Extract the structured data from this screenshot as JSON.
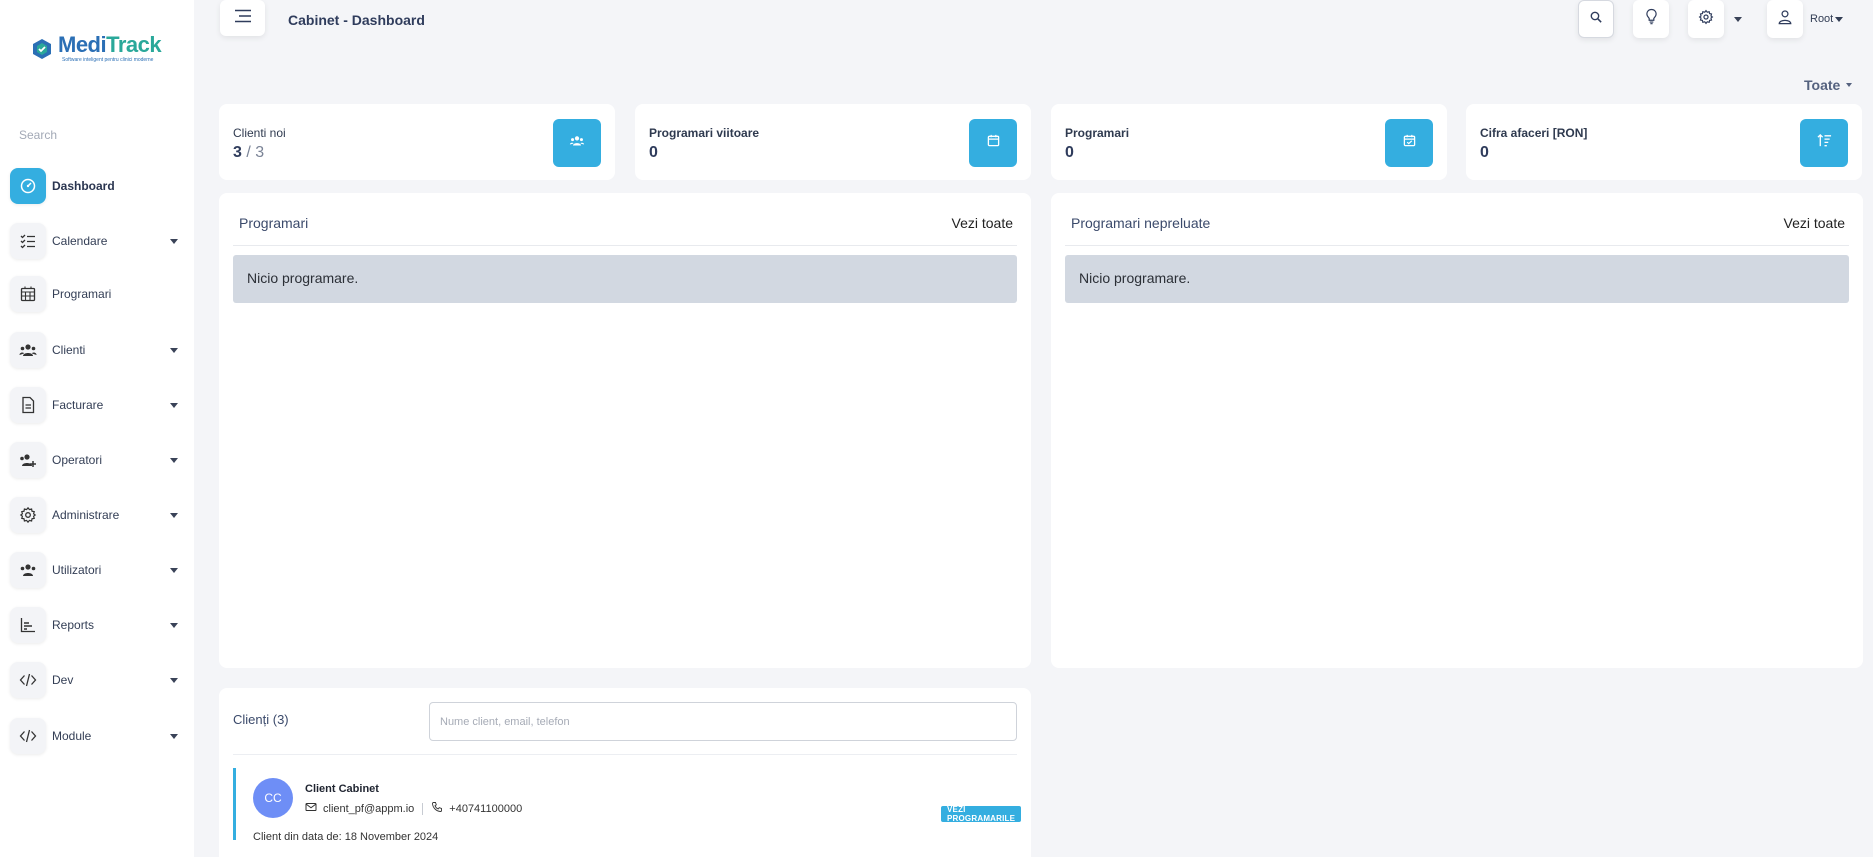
{
  "app": {
    "logo_name_part1": "Medi",
    "logo_name_part2": "Track",
    "logo_tagline": "Software inteligent pentru clinici moderne"
  },
  "sidebar": {
    "search_label": "Search",
    "items": [
      {
        "label": "Dashboard",
        "icon": "dashboard-icon",
        "active": true,
        "has_caret": false
      },
      {
        "label": "Calendare",
        "icon": "checklist-icon",
        "has_caret": true
      },
      {
        "label": "Programari",
        "icon": "calendar-grid-icon",
        "has_caret": false
      },
      {
        "label": "Clienti",
        "icon": "users-icon",
        "has_caret": true
      },
      {
        "label": "Facturare",
        "icon": "document-icon",
        "has_caret": true
      },
      {
        "label": "Operatori",
        "icon": "users-plus-icon",
        "has_caret": true
      },
      {
        "label": "Administrare",
        "icon": "gear-icon",
        "has_caret": true
      },
      {
        "label": "Utilizatori",
        "icon": "users-icon",
        "has_caret": true
      },
      {
        "label": "Reports",
        "icon": "bar-chart-icon",
        "has_caret": true
      },
      {
        "label": "Dev",
        "icon": "code-icon",
        "has_caret": true
      },
      {
        "label": "Module",
        "icon": "code-icon",
        "has_caret": true
      }
    ]
  },
  "header": {
    "title": "Cabinet - Dashboard",
    "user_name": "Root",
    "filter_label": "Toate"
  },
  "stats": [
    {
      "label": "Clienti noi",
      "value": "3",
      "of": "/ 3",
      "icon": "users-icon"
    },
    {
      "label": "Programari viitoare",
      "value": "0",
      "icon": "calendar-icon"
    },
    {
      "label": "Programari",
      "value": "0",
      "icon": "calendar-check-icon"
    },
    {
      "label": "Cifra afaceri [RON]",
      "value": "0",
      "icon": "sort-icon"
    }
  ],
  "panels": {
    "programari": {
      "title": "Programari",
      "link": "Vezi toate",
      "empty": "Nicio programare."
    },
    "nepreluate": {
      "title": "Programari nepreluate",
      "link": "Vezi toate",
      "empty": "Nicio programare."
    }
  },
  "clients": {
    "title": "Clienți (3)",
    "search_placeholder": "Nume client, email, telefon",
    "rows": [
      {
        "initials": "CC",
        "name": "Client Cabinet",
        "email": "client_pf@appm.io",
        "phone": "+40741100000",
        "since": "Client din data de: 18 November 2024",
        "button": "VEZI PROGRAMARILE"
      }
    ]
  },
  "colors": {
    "accent": "#34aee0",
    "avatar": "#6e8ef6",
    "empty_box": "#d2d8e1"
  }
}
